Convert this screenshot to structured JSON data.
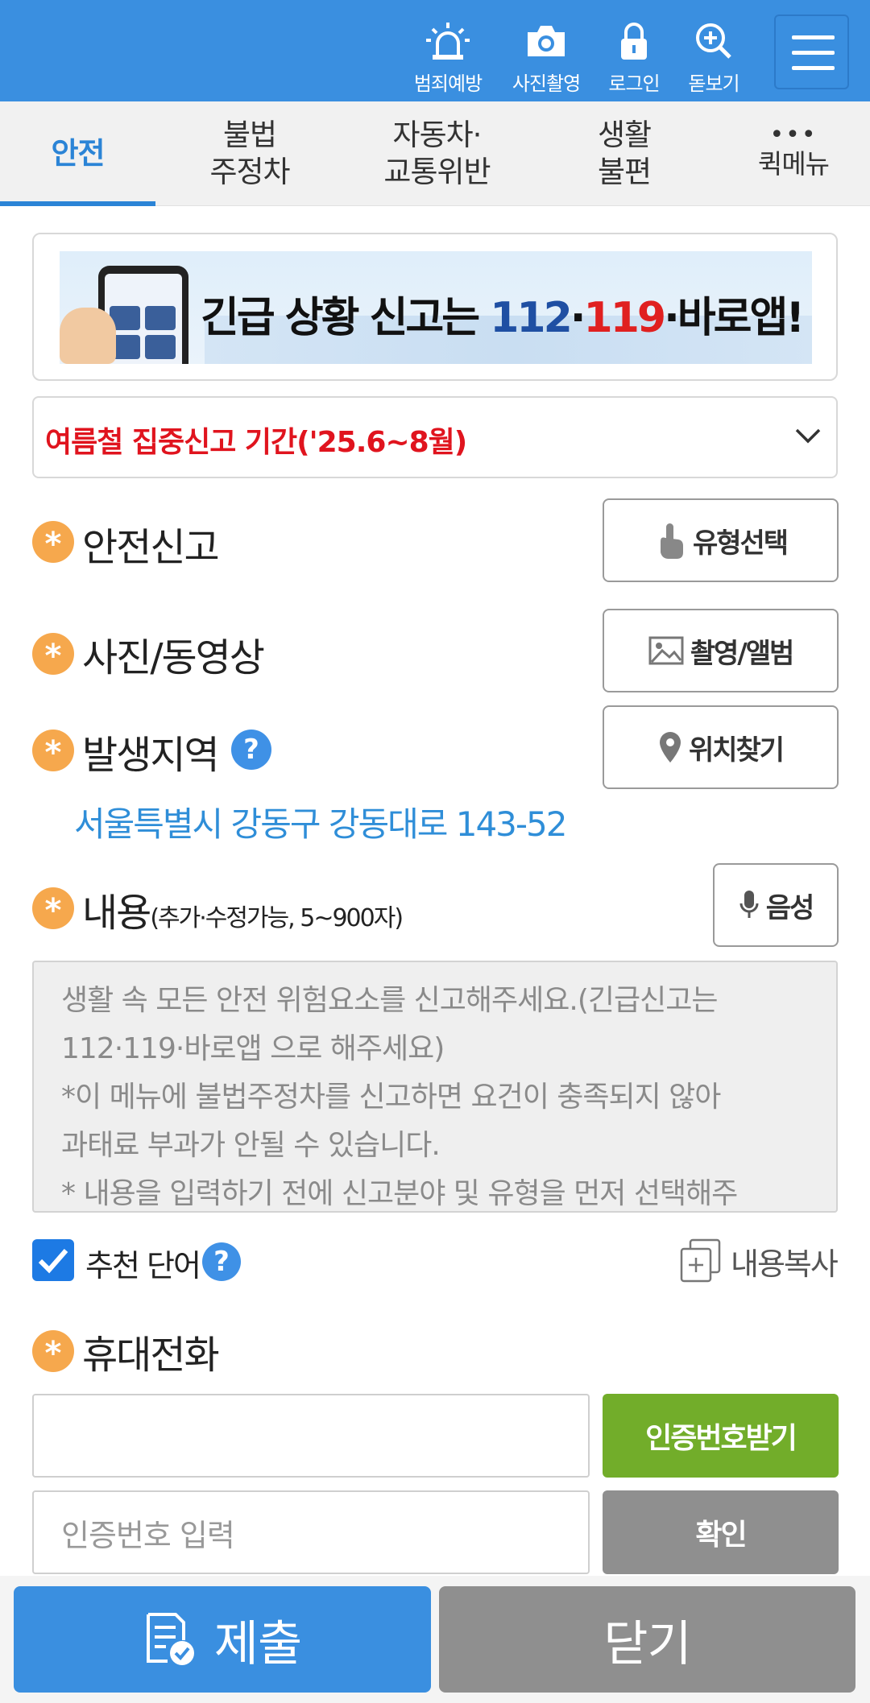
{
  "topbar": {
    "items": [
      {
        "label": "범죄예방",
        "icon": "siren-icon"
      },
      {
        "label": "사진촬영",
        "icon": "camera-icon"
      },
      {
        "label": "로그인",
        "icon": "lock-icon"
      },
      {
        "label": "돋보기",
        "icon": "zoom-icon"
      }
    ],
    "menu_icon": "hamburger-icon",
    "color": "#3a8fe0"
  },
  "tabs": [
    {
      "line1": "안전",
      "line2": ""
    },
    {
      "line1": "불법",
      "line2": "주정차"
    },
    {
      "line1": "자동차·",
      "line2": "교통위반"
    },
    {
      "line1": "생활",
      "line2": "불편"
    },
    {
      "line1": "•••",
      "line2": "퀵메뉴"
    }
  ],
  "banner": {
    "text_prefix": "긴급 상황 신고는 ",
    "num1": "112",
    "sep1": "·",
    "num2": "119",
    "sep2": "·",
    "suffix": "바로앱!"
  },
  "notice": {
    "text": "여름철 집중신고 기간('25.6~8월)"
  },
  "fields": {
    "safety": {
      "label": "안전신고",
      "button": "유형선택"
    },
    "photo": {
      "label": "사진/동영상",
      "button": "촬영/앨범"
    },
    "location": {
      "label": "발생지역",
      "help": "?",
      "button": "위치찾기",
      "address": "서울특별시 강동구 강동대로 143-52"
    },
    "content": {
      "label": "내용",
      "sublabel": "(추가·수정가능, 5~900자)",
      "button": "음성",
      "placeholder_lines": [
        "생활 속 모든 안전 위험요소를 신고해주세요.(긴급신고는",
        "112·119·바로앱 으로 해주세요)",
        "*이 메뉴에 불법주정차를 신고하면 요건이 충족되지 않아",
        "과태료 부과가 안될 수 있습니다.",
        "* 내용을 입력하기 전에 신고분야 및 유형을 먼저 선택해주"
      ]
    },
    "recommend": {
      "label": "추천 단어",
      "help": "?",
      "checked": true,
      "copy_label": "내용복사"
    },
    "phone": {
      "label": "휴대전화",
      "value": "",
      "request_button": "인증번호받기",
      "code_placeholder": "인증번호 입력",
      "confirm_button": "확인"
    }
  },
  "bottom": {
    "submit": "제출",
    "close": "닫기"
  },
  "colors": {
    "accent": "#3a8fe0",
    "required": "#f6a84d",
    "green": "#72ad2a",
    "gray": "#8f8f8f",
    "red": "#e0141e"
  }
}
